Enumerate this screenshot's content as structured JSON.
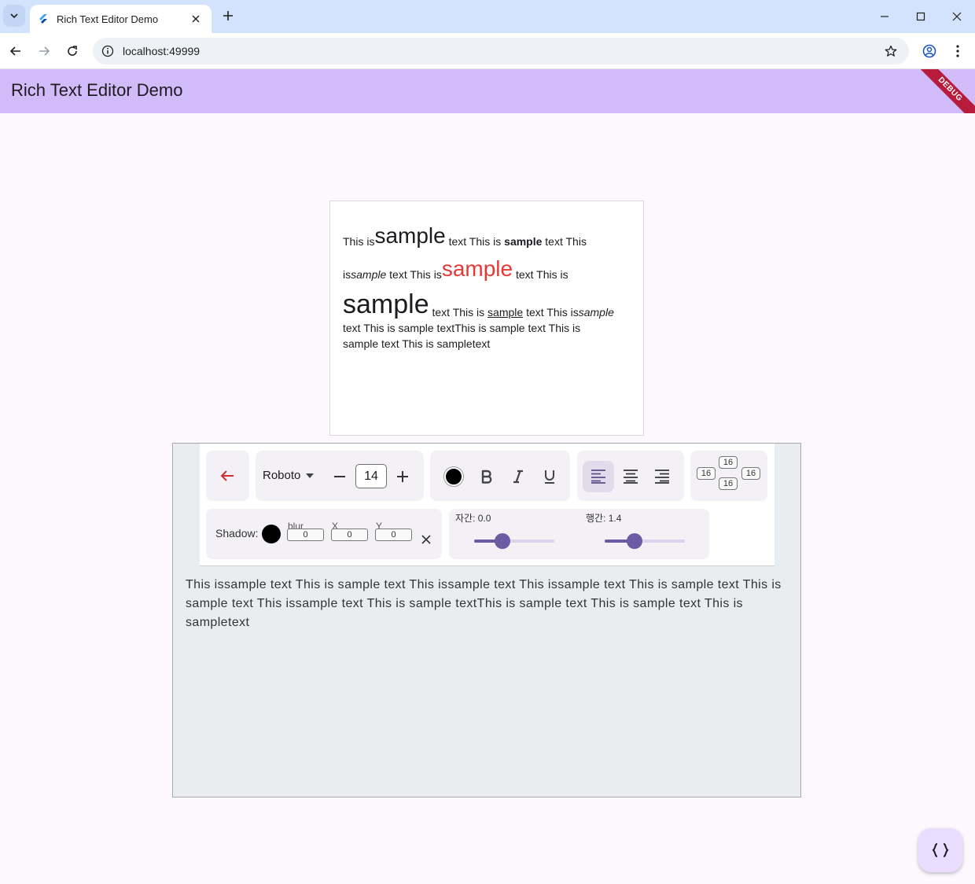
{
  "browser": {
    "tab_title": "Rich Text Editor Demo",
    "url": "localhost:49999"
  },
  "app": {
    "title": "Rich Text Editor Demo",
    "debug_banner": "DEBUG"
  },
  "preview": {
    "lines": [
      [
        {
          "t": "This is",
          "s": ""
        },
        {
          "t": "sample",
          "s": "big"
        },
        {
          "t": " text This is ",
          "s": ""
        },
        {
          "t": "sample",
          "s": "b"
        },
        {
          "t": " text This",
          "s": ""
        }
      ],
      [
        {
          "t": "is",
          "s": ""
        },
        {
          "t": "sample",
          "s": "i"
        },
        {
          "t": " text This is",
          "s": ""
        },
        {
          "t": "sample",
          "s": "big red"
        },
        {
          "t": " text This is",
          "s": ""
        }
      ],
      [
        {
          "t": "sample",
          "s": "huge"
        },
        {
          "t": " text This is ",
          "s": ""
        },
        {
          "t": "sample",
          "s": "u"
        },
        {
          "t": " text This is",
          "s": ""
        },
        {
          "t": "sample",
          "s": "i"
        }
      ],
      [
        {
          "t": "text This is sample textThis is sample text This is",
          "s": ""
        }
      ],
      [
        {
          "t": "sample text This is sampletext",
          "s": ""
        }
      ]
    ]
  },
  "toolbar": {
    "font_family": "Roboto",
    "font_size": "14",
    "padding_values": {
      "left": "16",
      "top": "16",
      "bottom": "16",
      "right": "16"
    },
    "text_color": "#000000",
    "shadow": {
      "label": "Shadow:",
      "color": "#000000",
      "blur_label": "blur",
      "blur_value": "0",
      "x_label": "X",
      "x_value": "0",
      "y_label": "Y",
      "y_value": "0"
    },
    "letter_spacing": {
      "label": "자간: 0.0",
      "value": 0.0,
      "level": 0.35
    },
    "line_height": {
      "label": "행간: 1.4",
      "value": 1.4,
      "level": 0.37
    },
    "selected_alignment": "left"
  },
  "editor": {
    "plain_text": "This issample text This is sample text This issample text This issample text This is sample text This is sample text This issample text This is sample textThis is sample text This is sample text This is sampletext"
  },
  "icons": {
    "back": "arrow-left-icon",
    "bold": "bold-icon",
    "italic": "italic-icon",
    "underline": "underline-icon",
    "fab": "code-braces-icon"
  },
  "colors": {
    "appbar": "#d2bbf9",
    "accent": "#6c5ba3",
    "back_arrow": "#d32f2f"
  }
}
